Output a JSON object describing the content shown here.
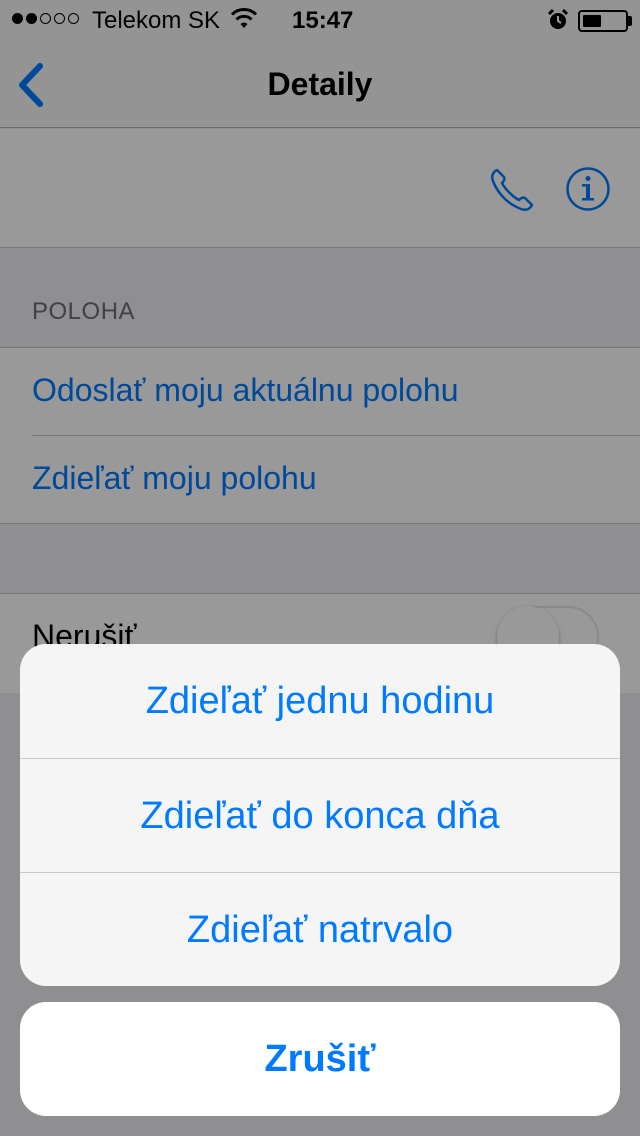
{
  "status_bar": {
    "signal_dots_filled": 2,
    "signal_dots_total": 5,
    "carrier": "Telekom SK",
    "time": "15:47",
    "battery_level": 0.45
  },
  "nav": {
    "title": "Detaily"
  },
  "actions": {
    "icons": [
      "phone-icon",
      "info-icon"
    ]
  },
  "location_section": {
    "header": "POLOHA",
    "items": [
      "Odoslať moju aktuálnu polohu",
      "Zdieľať moju polohu"
    ]
  },
  "do_not_disturb": {
    "label": "Nerušiť",
    "enabled": false
  },
  "action_sheet": {
    "options": [
      "Zdieľať jednu hodinu",
      "Zdieľať do konca dňa",
      "Zdieľať natrvalo"
    ],
    "cancel": "Zrušiť"
  },
  "colors": {
    "accent": "#007aff",
    "overlay": "rgba(0,0,0,0.4)"
  }
}
